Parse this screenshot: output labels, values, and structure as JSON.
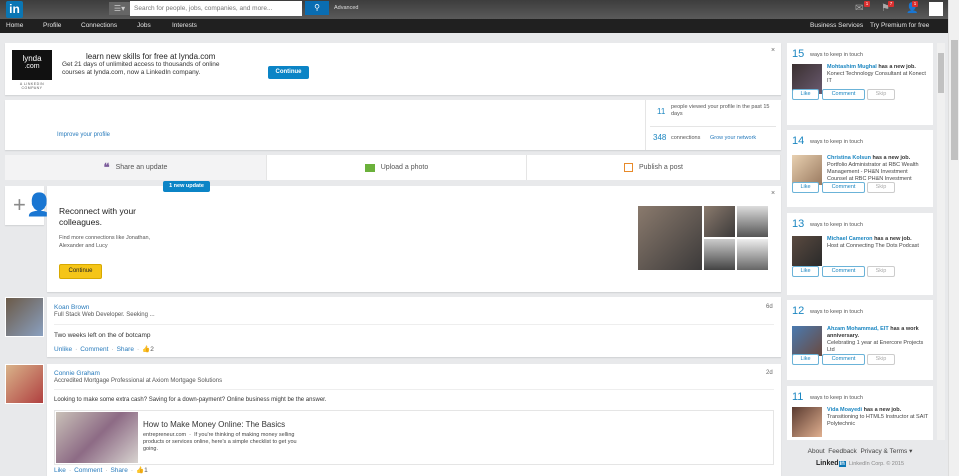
{
  "topbar": {
    "logo": "in",
    "search_placeholder": "Search for people, jobs, companies, and more...",
    "advanced": "Advanced",
    "icons": [
      {
        "name": "messages-icon",
        "badge": "1"
      },
      {
        "name": "notifications-flag-icon",
        "badge": "7"
      },
      {
        "name": "add-connections-icon",
        "badge": "1"
      }
    ]
  },
  "nav": {
    "items": [
      "Home",
      "Profile",
      "Connections",
      "Jobs",
      "Interests"
    ],
    "business": "Business Services",
    "premium": "Try Premium for free"
  },
  "lynda": {
    "logo_line1": "lynda",
    "logo_line2": ".com",
    "logo_sub": "A LINKEDIN COMPANY",
    "title": "learn new skills for free at lynda.com",
    "body": "Get 21 days of unlimited access to thousands of online courses at lynda.com, now a LinkedIn company.",
    "cta": "Continue",
    "close": "×"
  },
  "profile": {
    "improve": "Improve your profile",
    "views_count": "11",
    "views_text": "people viewed your profile in the past 15 days",
    "connections_count": "348",
    "connections_text": "connections",
    "grow": "Grow your network"
  },
  "share": {
    "update": "Share an update",
    "photo": "Upload a photo",
    "post": "Publish a post",
    "new_update": "1 new update"
  },
  "reconnect": {
    "title": "Reconnect with your colleagues.",
    "body": "Find more connections like Jonathan, Alexander and Lucy",
    "cta": "Continue",
    "close": "×"
  },
  "posts": [
    {
      "name": "Koan Brown",
      "headline": "Full Stack Web Developer. Seeking ...",
      "time": "6d",
      "text": "Two weeks left on the of botcamp",
      "actions": [
        "Unlike",
        "Comment",
        "Share"
      ],
      "likes": "2"
    },
    {
      "name": "Connie Graham",
      "headline": "Accredited Mortgage Professional at Axiom Mortgage Solutions",
      "time": "2d",
      "text": "Looking to make some extra cash? Saving for a down-payment? Online business might be the answer.",
      "link_title": "How to Make Money Online: The Basics",
      "link_source": "entrepreneur.com",
      "link_desc": "If you're thinking of making money selling products or services online, here's a simple checklist to get you going.",
      "actions": [
        "Like",
        "Comment",
        "Share"
      ],
      "likes": "1"
    }
  ],
  "rail": {
    "ways": "ways to keep in touch",
    "buttons": {
      "like": "Like",
      "comment": "Comment",
      "skip": "Skip"
    },
    "cards": [
      {
        "count": "15",
        "name": "Mohtashim Mughal",
        "event": " has a new job.",
        "detail": "Konect Technology Consultant at Konect IT"
      },
      {
        "count": "14",
        "name": "Christina Kolsun",
        "event": " has a new job.",
        "detail": "Portfolio Administrator at RBC Wealth Management - PH&N Investment Counsel at RBC PH&N Investment"
      },
      {
        "count": "13",
        "name": "Michael Cameron",
        "event": " has a new job.",
        "detail": "Host at Connecting The Dots Podcast"
      },
      {
        "count": "12",
        "name": "Ahzam Mohammad, EIT",
        "event": " has a work anniversary.",
        "detail": "Celebrating 1 year at Enercore Projects Ltd"
      },
      {
        "count": "11",
        "name": "Vida Moayedi",
        "event": " has a new job.",
        "detail": "Transitioning to HTML5 Instructor at SAIT Polytechnic"
      }
    ]
  },
  "footer": {
    "links": [
      "About",
      "Feedback",
      "Privacy & Terms ▾"
    ],
    "brand": "Linked",
    "brand_in": "in",
    "copyright": "LinkedIn Corp. © 2015"
  },
  "colors": {
    "accent": "#0b84c6",
    "link": "#287bbc",
    "yellow_cta": "#f5c518"
  }
}
